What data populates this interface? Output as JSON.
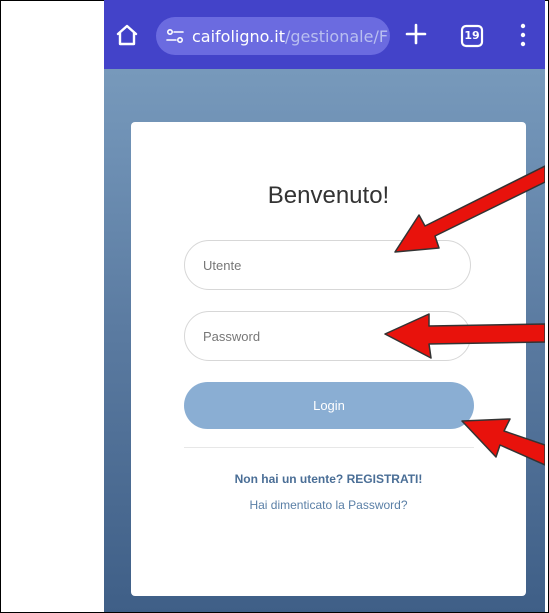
{
  "browser": {
    "url_host": "caifoligno.it",
    "url_path": "/gestionale/F",
    "tab_count": "19",
    "bar_color": "#4343c9"
  },
  "login": {
    "title": "Benvenuto!",
    "username_placeholder": "Utente",
    "password_placeholder": "Password",
    "login_label": "Login",
    "register_text": "Non hai un utente? REGISTRATI!",
    "forgot_text": "Hai dimenticato la Password?",
    "button_color": "#8aaed3"
  },
  "annotations": {
    "arrow_color": "#e8120c",
    "arrows": [
      {
        "name": "arrow-to-username",
        "target": "username-input"
      },
      {
        "name": "arrow-to-password",
        "target": "password-input"
      },
      {
        "name": "arrow-to-login",
        "target": "login-button"
      }
    ]
  }
}
